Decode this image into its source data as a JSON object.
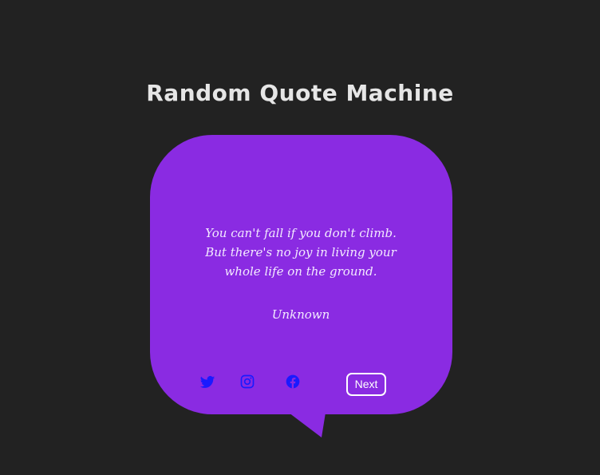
{
  "header": {
    "title": "Random Quote Machine"
  },
  "quote_card": {
    "text": "You can't fall if you don't climb. But there's no joy in living your whole life on the ground.",
    "author": "Unknown",
    "bubble_color": "#8a2be2"
  },
  "actions": {
    "share_icons": [
      "twitter-icon",
      "instagram-icon",
      "facebook-icon"
    ],
    "icon_color": "#1a1aff",
    "next_label": "Next"
  },
  "theme": {
    "background": "#222222",
    "title_color": "#e6e6e6",
    "text_color": "#f3eaff"
  }
}
